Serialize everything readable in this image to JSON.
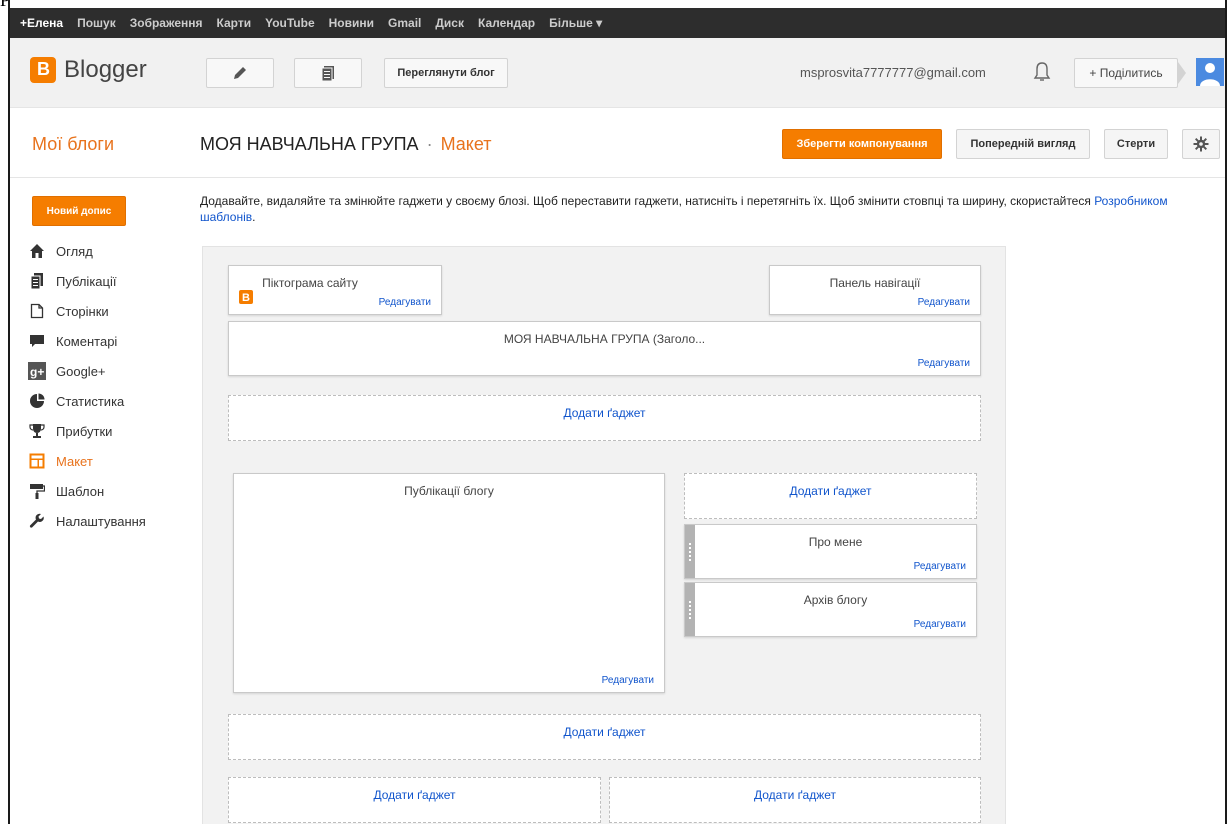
{
  "topbar": {
    "items": [
      "+Елена",
      "Пошук",
      "Зображення",
      "Карти",
      "YouTube",
      "Новини",
      "Gmail",
      "Диск",
      "Календар",
      "Більше ▾"
    ]
  },
  "header": {
    "logo_text": "Blogger",
    "view_blog": "Переглянути блог",
    "email": "msprosvita7777777@gmail.com",
    "share": "+ Поділитись"
  },
  "titlebar": {
    "my_blogs": "Мої блоги",
    "blog_name": "МОЯ НАВЧАЛЬНА ГРУПА",
    "separator": "·",
    "section": "Макет",
    "save": "Зберегти компонування",
    "preview": "Попередній вигляд",
    "clear": "Стерти"
  },
  "sidebar": {
    "new_post": "Новий допис",
    "items": [
      {
        "label": "Огляд",
        "icon": "home-icon"
      },
      {
        "label": "Публікації",
        "icon": "posts-icon"
      },
      {
        "label": "Сторінки",
        "icon": "pages-icon"
      },
      {
        "label": "Коментарі",
        "icon": "comments-icon"
      },
      {
        "label": "Google+",
        "icon": "google-plus-icon"
      },
      {
        "label": "Статистика",
        "icon": "stats-icon"
      },
      {
        "label": "Прибутки",
        "icon": "trophy-icon"
      },
      {
        "label": "Макет",
        "icon": "layout-icon"
      },
      {
        "label": "Шаблон",
        "icon": "template-icon"
      },
      {
        "label": "Налаштування",
        "icon": "wrench-icon"
      }
    ]
  },
  "intro": {
    "text": "Додавайте, видаляйте та змінюйте гаджети у своєму блозі. Щоб переставити гаджети, натисніть і перетягніть їх. Щоб змінити стовпці та ширину, скористайтеся ",
    "link": "Розробником шаблонів",
    "end": "."
  },
  "layout": {
    "favicon_title": "Піктограма сайту",
    "navbar_title": "Панель навігації",
    "header_title": "МОЯ НАВЧАЛЬНА ГРУПА (Заголо...",
    "posts_title": "Публікації блогу",
    "about_title": "Про мене",
    "archive_title": "Архів блогу",
    "edit": "Редагувати",
    "add_gadget": "Додати ґаджет"
  },
  "colors": {
    "accent": "#f57d00",
    "link": "#1155cc"
  }
}
